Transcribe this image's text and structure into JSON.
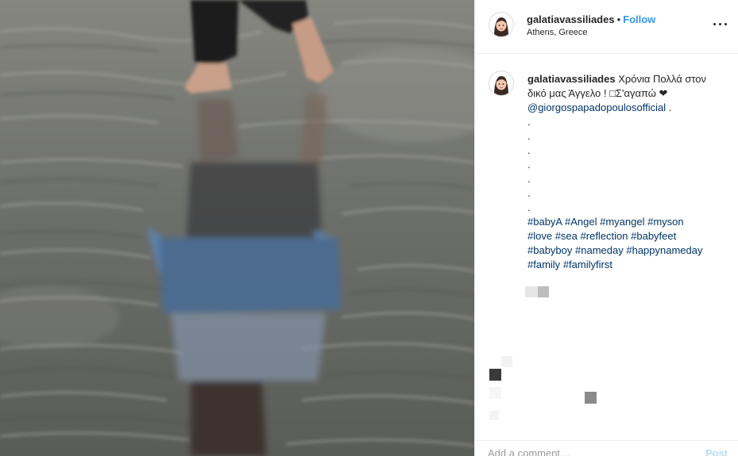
{
  "post": {
    "username": "galatiavassiliades",
    "separator": "•",
    "follow_label": "Follow",
    "location": "Athens, Greece"
  },
  "caption": {
    "username": "galatiavassiliades",
    "text": "Χρόνια Πολλά στον δικό μας Άγγελο ! □Σ'αγαπώ ❤",
    "mention": "@giorgospapadopoulosofficial",
    "mention_suffix": " .",
    "dot": ".",
    "hashtags": [
      "#babyA",
      "#Angel",
      "#myangel",
      "#myson",
      "#love",
      "#sea",
      "#reflection",
      "#babyfeet",
      "#babyboy",
      "#nameday",
      "#happynameday",
      "#family",
      "#familyfirst"
    ]
  },
  "comment_box": {
    "placeholder": "Add a comment…",
    "post_label": "Post"
  },
  "icons": {
    "more": "more-options-icon",
    "avatar": "memoji-avatar-icon"
  },
  "colors": {
    "link": "#3897f0",
    "hashtag": "#003569",
    "text": "#262626"
  }
}
